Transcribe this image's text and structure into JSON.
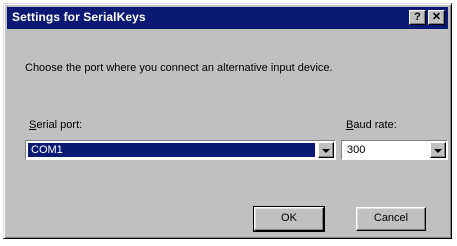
{
  "window": {
    "title": "Settings for SerialKeys",
    "help_label": "?",
    "close_label": "✕"
  },
  "instruction": "Choose the port where you connect an alternative input device.",
  "serial_port": {
    "label_underlined": "S",
    "label_rest": "erial port:",
    "value": "COM1"
  },
  "baud_rate": {
    "label_underlined": "B",
    "label_rest": "aud rate:",
    "value": "300"
  },
  "buttons": {
    "ok": "OK",
    "cancel": "Cancel"
  },
  "colors": {
    "titlebar": "#0a1a74",
    "selection": "#0a1a74",
    "face": "#c0c0c0"
  }
}
